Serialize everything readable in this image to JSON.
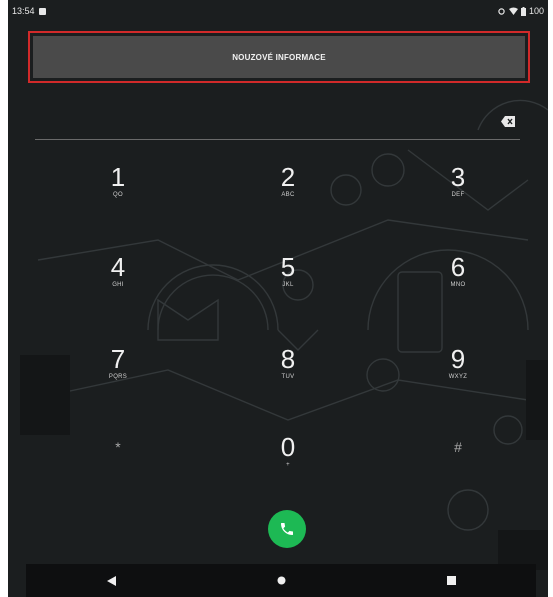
{
  "status_bar": {
    "time": "13:54",
    "battery": "100"
  },
  "emergency": {
    "label": "NOUZOVÉ INFORMACE"
  },
  "dialer": {
    "number": ""
  },
  "keypad": [
    {
      "digit": "1",
      "letters": "QO"
    },
    {
      "digit": "2",
      "letters": "ABC"
    },
    {
      "digit": "3",
      "letters": "DEF"
    },
    {
      "digit": "4",
      "letters": "GHI"
    },
    {
      "digit": "5",
      "letters": "JKL"
    },
    {
      "digit": "6",
      "letters": "MNO"
    },
    {
      "digit": "7",
      "letters": "PQRS"
    },
    {
      "digit": "8",
      "letters": "TUV"
    },
    {
      "digit": "9",
      "letters": "WXYZ"
    },
    {
      "digit": "*",
      "letters": ""
    },
    {
      "digit": "0",
      "letters": "+"
    },
    {
      "digit": "#",
      "letters": ""
    }
  ],
  "colors": {
    "call": "#1db954",
    "emergency_border": "#d22a2a",
    "background": "#1b1e1f"
  }
}
